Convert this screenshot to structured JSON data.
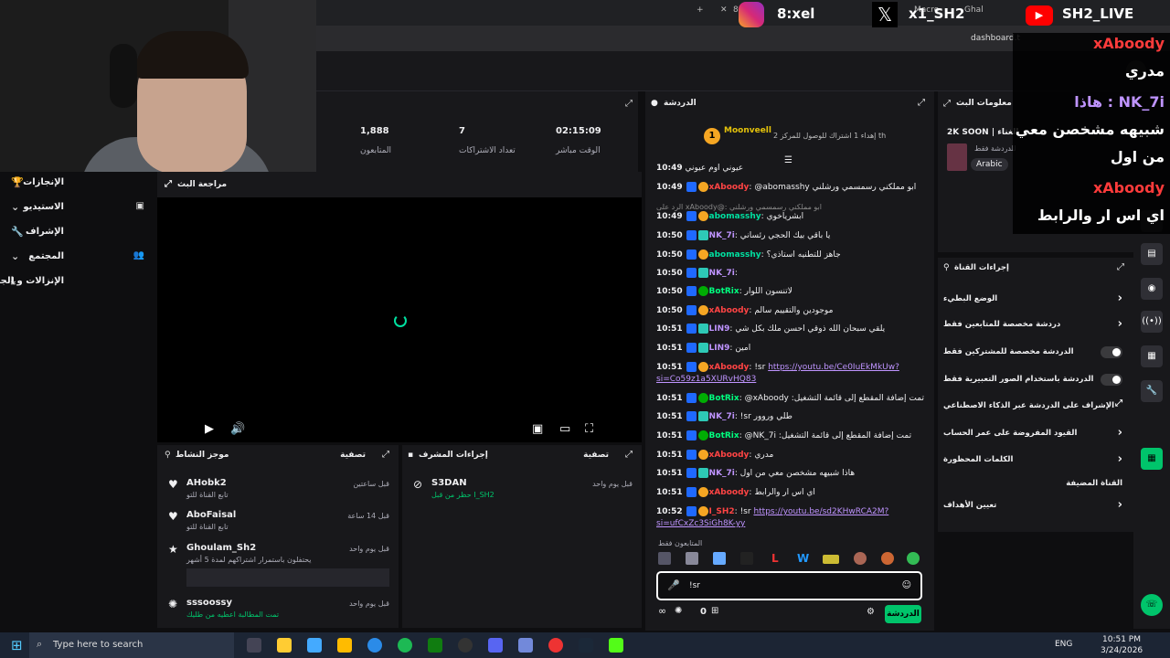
{
  "browser": {
    "tabs": [
      "8",
      "Clo",
      "ing Bot",
      "Macro",
      "Ab",
      "Ghal"
    ],
    "url": "dashboard.t"
  },
  "social": {
    "instagram": "8:xel",
    "x": "x1_SH2",
    "youtube": "SH2_LIVE"
  },
  "overlay": {
    "lines": [
      "xAboody",
      "مدري",
      "هاذا : NK_7i",
      "شبيهه مشخصن معي",
      "من اول",
      "xAboody",
      "اي اس ار والرابط"
    ]
  },
  "leftnav": {
    "items": [
      "الإنجازات",
      "الاستيديو",
      "الإشراف",
      "المجتمع",
      "الإنزالات و الجوائز"
    ]
  },
  "stats": {
    "viewers_value": "1,888",
    "viewers_label": "المتابعون",
    "subs_value": "7",
    "subs_label": "تعداد الاشتراكات",
    "live_value": "02:15:09",
    "live_label": "الوقت مباشر"
  },
  "preview": {
    "title": "مراجعة البث"
  },
  "activity": {
    "title": "موجز النشاط",
    "filter": "تصفية",
    "items": [
      {
        "name": "AHobk2",
        "sub": "تابع القناة للتو",
        "time": "قبل ساعتين"
      },
      {
        "name": "AboFaisal",
        "sub": "تابع القناة للتو",
        "time": "قبل 14 ساعة"
      },
      {
        "name": "Ghoulam_Sh2",
        "sub": "يحتفلون باستمرار اشتراكهم لمدة 5 أشهر",
        "time": "قبل يوم واحد"
      },
      {
        "name": "sssoossy",
        "sub": "تمت المطالبة اعطيه من طليك",
        "time": "قبل يوم واحد"
      }
    ]
  },
  "modactions": {
    "title": "إجراءات المشرف",
    "filter": "تصفية",
    "items": [
      {
        "name": "S3DAN",
        "sub": "حظر من قبل I_SH2",
        "time": "قبل يوم واحد"
      }
    ]
  },
  "chat": {
    "title": "الدردشة",
    "pinned_user": "Moonveell",
    "pinned_text": "إهداء 1 اشتراك للوصول للمركز 2 th",
    "messages": [
      {
        "time": "10:49",
        "user": "",
        "text": "عيوني اوم عيوني"
      },
      {
        "time": "10:49",
        "user": "xAboody",
        "text": "@abomasshy ابو مملكني رسمسمي ورشلني"
      },
      {
        "time": "",
        "user": "",
        "text": "الرد على xAboody@: ابو مملكني رسمسمي ورشلني"
      },
      {
        "time": "10:49",
        "user": "abomasshy",
        "text": "ابشرياخوي"
      },
      {
        "time": "10:50",
        "user": "NK_7i",
        "text": "يا باقي بيك الحجي رئساني"
      },
      {
        "time": "10:50",
        "user": "abomasshy",
        "text": "جاهز للتطنيه استاذي؟"
      },
      {
        "time": "10:50",
        "user": "NK_7i",
        "text": ""
      },
      {
        "time": "10:50",
        "user": "BotRix",
        "text": "لاتنسون اللوار"
      },
      {
        "time": "10:50",
        "user": "xAboody",
        "text": "موجودين والتقييم سالم"
      },
      {
        "time": "10:51",
        "user": "LIN9",
        "text": "يلقي سبحان الله ذوقي احسن ملك بكل شي"
      },
      {
        "time": "10:51",
        "user": "LIN9",
        "text": "امين"
      },
      {
        "time": "10:51",
        "user": "xAboody",
        "text": "!sr",
        "link": "https://youtu.be/Ce0IuEkMkUw?si=Co59z1a5XURvHQ83"
      },
      {
        "time": "10:51",
        "user": "BotRix",
        "text": "@xAboody :تمت إضافة المقطع إلى قائمة التشغيل"
      },
      {
        "time": "10:51",
        "user": "NK_7i",
        "text": "!sr طلي وروور"
      },
      {
        "time": "10:51",
        "user": "BotRix",
        "text": "@NK_7i :تمت إضافة المقطع إلى قائمة التشغيل"
      },
      {
        "time": "10:51",
        "user": "xAboody",
        "text": "مدري"
      },
      {
        "time": "10:51",
        "user": "NK_7i",
        "text": "هاذا شبيهه مشخصن معي من اول"
      },
      {
        "time": "10:51",
        "user": "xAboody",
        "text": "اي اس ار والرابط"
      },
      {
        "time": "10:52",
        "user": "I_SH2",
        "text": "!sr",
        "link": "https://youtu.be/sd2KHwRCA2M?si=ufCxZc3SiGh8K-yy"
      }
    ],
    "followers_only": "المتابعون فقط",
    "input_value": "!sr",
    "send_label": "الدردشة",
    "points": "0"
  },
  "streaminfo": {
    "title": "معلومات البث",
    "stream_title": "2K SOON | الغناء",
    "category": "للدردشة فقط",
    "language": "Arabic"
  },
  "channelactions": {
    "title": "إجراءات القناة",
    "rows": [
      {
        "label": "الوضع البطيء",
        "kind": "chev"
      },
      {
        "label": "دردشة مخصصة للمتابعين فقط",
        "kind": "chev"
      },
      {
        "label": "الدردشة مخصصة للمشتركين فقط",
        "kind": "toggle"
      },
      {
        "label": "الدردشة باستخدام الصور التعبيرية فقط",
        "kind": "toggle"
      },
      {
        "label": "الإشراف على الدردشة عبر الذكاء الاصطناعي",
        "kind": "ext"
      },
      {
        "label": "القيود المفروضة على عمر الحساب",
        "kind": "chev"
      },
      {
        "label": "الكلمات المحظورة",
        "kind": "chev"
      },
      {
        "label": "القناة المضيفة",
        "kind": "none"
      },
      {
        "label": "تعيين الأهداف",
        "kind": "chev"
      }
    ]
  },
  "taskbar": {
    "search_placeholder": "Type here to search",
    "lang": "ENG",
    "time": "10:51 PM",
    "date": "3/24/2026"
  },
  "colors": {
    "accent": "#00c46b",
    "mod": "#1f69ff",
    "username_red": "#ff4444",
    "botrix": "#00ff7f"
  }
}
